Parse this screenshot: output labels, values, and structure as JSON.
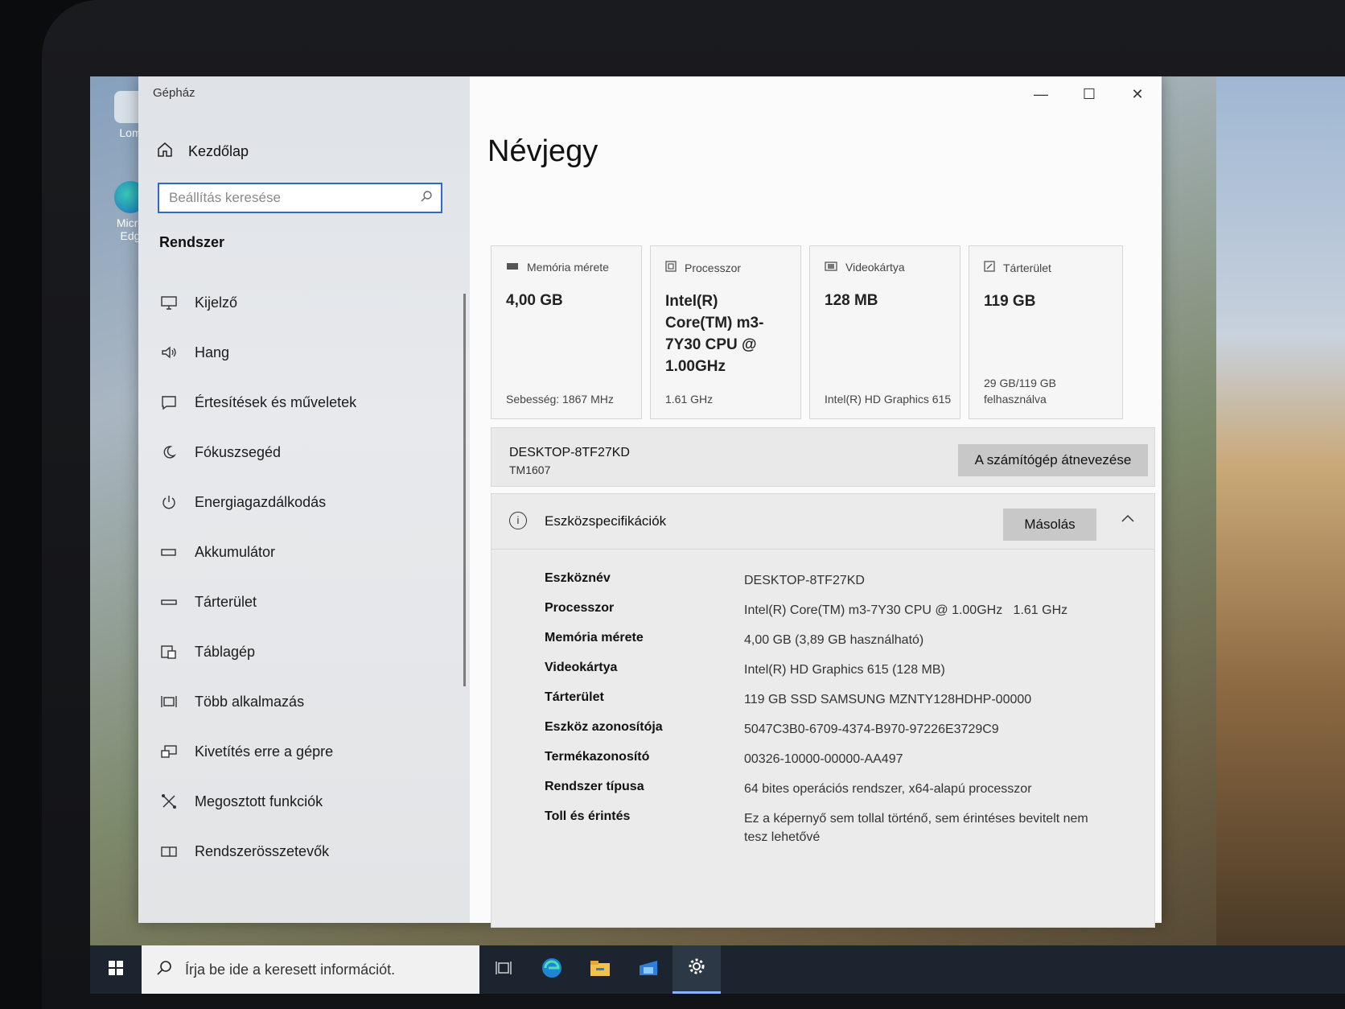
{
  "window": {
    "title": "Gépház",
    "minimize": "—",
    "maximize": "☐",
    "close": "✕"
  },
  "sidebar": {
    "home_label": "Kezdőlap",
    "search_placeholder": "Beállítás keresése",
    "section_title": "Rendszer",
    "items": [
      {
        "label": "Kijelző",
        "icon": "monitor-icon"
      },
      {
        "label": "Hang",
        "icon": "speaker-icon"
      },
      {
        "label": "Értesítések és műveletek",
        "icon": "notification-icon"
      },
      {
        "label": "Fókuszsegéd",
        "icon": "moon-icon"
      },
      {
        "label": "Energiagazdálkodás",
        "icon": "power-icon"
      },
      {
        "label": "Akkumulátor",
        "icon": "battery-icon"
      },
      {
        "label": "Tárterület",
        "icon": "storage-icon"
      },
      {
        "label": "Táblagép",
        "icon": "tablet-icon"
      },
      {
        "label": "Több alkalmazás",
        "icon": "multitasking-icon"
      },
      {
        "label": "Kivetítés erre a gépre",
        "icon": "projecting-icon"
      },
      {
        "label": "Megosztott funkciók",
        "icon": "shared-icon"
      },
      {
        "label": "Rendszerösszetevők",
        "icon": "components-icon"
      }
    ]
  },
  "main": {
    "page_title": "Névjegy",
    "cards": [
      {
        "header": "Memória mérete",
        "value": "4,00 GB",
        "sub": "Sebesség: 1867 MHz",
        "icon": "memory-icon"
      },
      {
        "header": "Processzor",
        "value": "Intel(R) Core(TM) m3-7Y30 CPU @ 1.00GHz",
        "sub": "1.61 GHz",
        "icon": "cpu-icon"
      },
      {
        "header": "Videokártya",
        "value": "128 MB",
        "sub": "Intel(R) HD Graphics 615",
        "icon": "gpu-icon"
      },
      {
        "header": "Tárterület",
        "value": "119 GB",
        "sub": "29 GB/119 GB felhasználva",
        "icon": "storage-icon"
      }
    ],
    "device": {
      "name": "DESKTOP-8TF27KD",
      "model": "TM1607",
      "rename_label": "A számítógép átnevezése"
    },
    "specs": {
      "title": "Eszközspecifikációk",
      "copy_label": "Másolás",
      "rows": [
        {
          "key": "Eszköznév",
          "value": "DESKTOP-8TF27KD"
        },
        {
          "key": "Processzor",
          "value": "Intel(R) Core(TM) m3-7Y30 CPU @ 1.00GHz   1.61 GHz"
        },
        {
          "key": "Memória mérete",
          "value": "4,00 GB (3,89 GB használható)"
        },
        {
          "key": "Videokártya",
          "value": "Intel(R) HD Graphics 615 (128 MB)"
        },
        {
          "key": "Tárterület",
          "value": "119 GB SSD SAMSUNG MZNTY128HDHP-00000"
        },
        {
          "key": "Eszköz azonosítója",
          "value": "5047C3B0-6709-4374-B970-97226E3729C9"
        },
        {
          "key": "Termékazonosító",
          "value": "00326-10000-00000-AA497"
        },
        {
          "key": "Rendszer típusa",
          "value": "64 bites operációs rendszer, x64-alapú processzor"
        },
        {
          "key": "Toll és érintés",
          "value": "Ez a képernyő sem tollal történő, sem érintéses bevitelt nem tesz lehetővé"
        }
      ]
    }
  },
  "desktop": {
    "icons": [
      {
        "label": "Lom",
        "icon": "recycle-bin-icon"
      },
      {
        "label": "Micro Edg",
        "icon": "edge-icon"
      }
    ]
  },
  "taskbar": {
    "search_placeholder": "Írja be ide a keresett információt.",
    "icons": [
      "windows-logo-icon",
      "task-view-icon",
      "edge-icon",
      "file-explorer-icon",
      "store-icon",
      "settings-icon"
    ]
  },
  "colors": {
    "accent": "#2e6bc6",
    "taskbar": "#1c2430"
  }
}
